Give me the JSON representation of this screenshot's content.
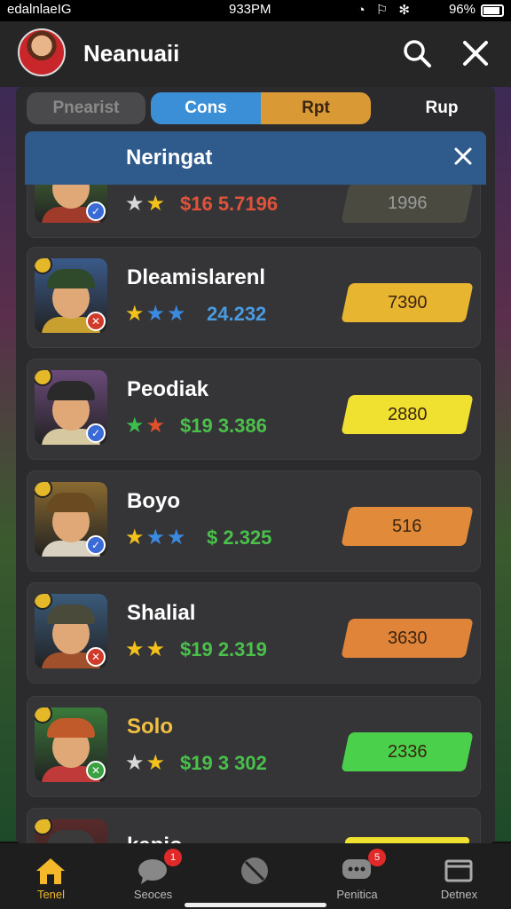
{
  "status_bar": {
    "carrier": "edalnlaeIG",
    "time": "933PM",
    "battery": "96%"
  },
  "header": {
    "title": "Neanuaii"
  },
  "tabs": [
    "Pnearist",
    "Cons",
    "Rpt",
    "Rup"
  ],
  "banner": {
    "title": "Neringat"
  },
  "players": [
    {
      "name": "",
      "stars": [
        "silver",
        "gold"
      ],
      "stat": "$16 5.7196",
      "stat_color": "#e0533a",
      "price": "1996",
      "price_color": "#4a4a40",
      "hat": "#d8c7a8",
      "body": "#a03a2a",
      "bg": "#4a7a3a",
      "badge": "#3a6ad6",
      "badge_icon": "✓"
    },
    {
      "name": "Dleamislarenl",
      "stars": [
        "gold",
        "blue",
        "blue"
      ],
      "stat": "24.232",
      "stat_color": "#4a9ae0",
      "price": "7390",
      "price_color": "#e8b530",
      "hat": "#2e4a2a",
      "body": "#c8a030",
      "bg": "#3a5a8a",
      "badge": "#d03a2a",
      "badge_icon": "✕"
    },
    {
      "name": "Peodiak",
      "stars": [
        "green",
        "red"
      ],
      "stat": "$19 3.386",
      "stat_color": "#4ac04a",
      "price": "2880",
      "price_color": "#f0e030",
      "hat": "#2a2a2a",
      "body": "#d6c8a0",
      "bg": "#6a4a7a",
      "badge": "#3a6ad6",
      "badge_icon": "✓"
    },
    {
      "name": "Boyo",
      "stars": [
        "gold",
        "blue",
        "blue"
      ],
      "stat": "$ 2.325",
      "stat_color": "#4ac04a",
      "price": "516",
      "price_color": "#e08a3a",
      "hat": "#6a4a20",
      "body": "#d8d0c0",
      "bg": "#8a6a30",
      "badge": "#3a6ad6",
      "badge_icon": "✓"
    },
    {
      "name": "Shalial",
      "stars": [
        "gold",
        "gold"
      ],
      "stat": "$19 2.319",
      "stat_color": "#4ac04a",
      "price": "3630",
      "price_color": "#e0843a",
      "hat": "#4a4a3a",
      "body": "#a0502a",
      "bg": "#3a5a7a",
      "badge": "#d03a2a",
      "badge_icon": "✕"
    },
    {
      "name": "Solo",
      "stars": [
        "silver",
        "gold"
      ],
      "stat": "$19 3 302",
      "stat_color": "#4ac04a",
      "price": "2336",
      "price_color": "#4ad04a",
      "hat": "#c05a2a",
      "body": "#c03a3a",
      "bg": "#3a7a3a",
      "badge": "#3aa040",
      "badge_icon": "✕"
    },
    {
      "name": "kapio",
      "stars": [],
      "stat": "",
      "stat_color": "#4ac04a",
      "price": "",
      "price_color": "#f0e030",
      "hat": "#3a3a3a",
      "body": "#5a2a2a",
      "bg": "#5a2a2a",
      "badge": "#3a6ad6",
      "badge_icon": ""
    }
  ],
  "star_colors": {
    "gold": "#f4c21a",
    "silver": "#d8d8d8",
    "blue": "#3a8ae0",
    "green": "#3ac04a",
    "red": "#e0502a"
  },
  "bottom_nav": [
    {
      "label": "Tenel",
      "icon": "home-icon",
      "badge": ""
    },
    {
      "label": "Seoces",
      "icon": "chat-icon",
      "badge": "1"
    },
    {
      "label": "",
      "icon": "ball-icon",
      "badge": ""
    },
    {
      "label": "Penitica",
      "icon": "message-icon",
      "badge": "5"
    },
    {
      "label": "Detnex",
      "icon": "window-icon",
      "badge": ""
    }
  ]
}
